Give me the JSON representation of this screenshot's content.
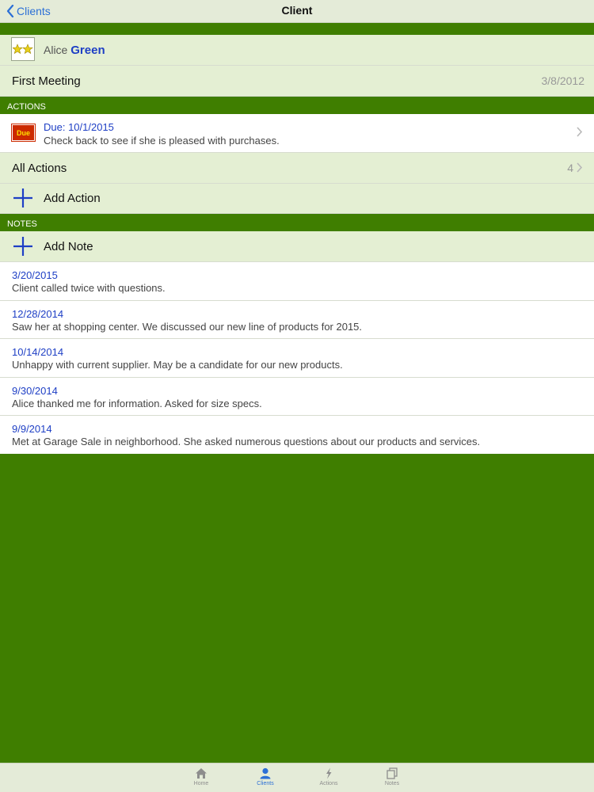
{
  "nav": {
    "back_label": "Clients",
    "title": "Client"
  },
  "client": {
    "first_name": "Alice",
    "last_name": "Green",
    "rating_icon": "two-stars-icon"
  },
  "first_meeting": {
    "label": "First Meeting",
    "date": "3/8/2012"
  },
  "actions_section": {
    "header": "ACTIONS",
    "items": [
      {
        "badge": "Due",
        "due": "Due: 10/1/2015",
        "text": "Check back to see if she is pleased with purchases."
      }
    ],
    "all_label": "All Actions",
    "all_count": "4",
    "add_label": "Add Action"
  },
  "notes_section": {
    "header": "NOTES",
    "add_label": "Add Note",
    "items": [
      {
        "date": "3/20/2015",
        "text": "Client called twice with questions."
      },
      {
        "date": "12/28/2014",
        "text": "Saw her at shopping center. We discussed our new line of products for 2015."
      },
      {
        "date": "10/14/2014",
        "text": "Unhappy with current supplier. May be a candidate for our new products."
      },
      {
        "date": "9/30/2014",
        "text": "Alice thanked me for information. Asked for size specs."
      },
      {
        "date": "9/9/2014",
        "text": "Met at Garage Sale in neighborhood. She asked numerous questions about our products and services."
      }
    ]
  },
  "tabbar": {
    "tabs": [
      {
        "label": "Home",
        "icon": "home-icon"
      },
      {
        "label": "Clients",
        "icon": "person-icon"
      },
      {
        "label": "Actions",
        "icon": "lightning-icon"
      },
      {
        "label": "Notes",
        "icon": "notes-icon"
      }
    ],
    "active_tab": "Clients"
  },
  "colors": {
    "accent_green": "#3f7e00",
    "row_tint": "#e4efd3",
    "link_blue": "#1e3fc5",
    "ios_blue": "#2b6fd6",
    "due_red": "#cc2a00"
  }
}
